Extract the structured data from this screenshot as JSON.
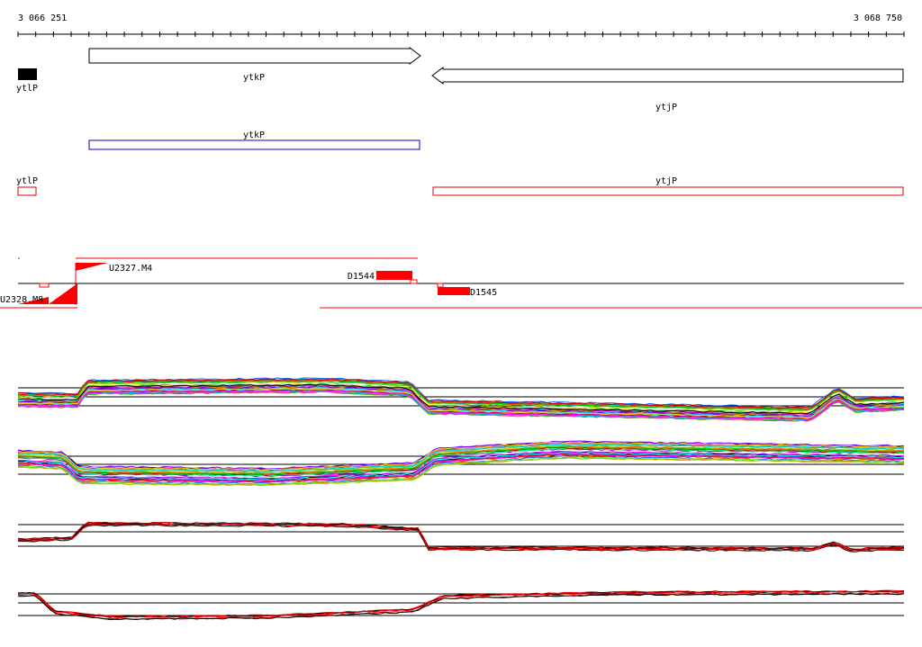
{
  "coordinates": {
    "start_label": "3 066 251",
    "end_label": "3 068 750"
  },
  "genes": [
    {
      "id": "ytlP",
      "label": "ytlP",
      "strand": "+"
    },
    {
      "id": "ytkP",
      "label": "ytkP",
      "strand": "+"
    },
    {
      "id": "ytjP",
      "label": "ytjP",
      "strand": "-"
    }
  ],
  "transcription_units": [
    {
      "id": "ytkP",
      "label": "ytkP",
      "color": "#0000cc"
    },
    {
      "id": "ytlP",
      "label": "ytlP",
      "color": "#dd0000"
    },
    {
      "id": "ytjP",
      "label": "ytjP",
      "color": "#dd0000"
    }
  ],
  "promoters": [
    {
      "label": "U2327.M4"
    },
    {
      "label": "U2328.M8"
    },
    {
      "label": "D1544"
    },
    {
      "label": "D1545"
    }
  ],
  "expression_tracks": [
    {
      "name": "expression-track-1"
    },
    {
      "name": "expression-track-2"
    },
    {
      "name": "expression-track-3"
    },
    {
      "name": "expression-track-4"
    }
  ],
  "colors": {
    "gene_fill": "#ffffff",
    "promoter": "#ff0000",
    "axis": "#000000"
  }
}
